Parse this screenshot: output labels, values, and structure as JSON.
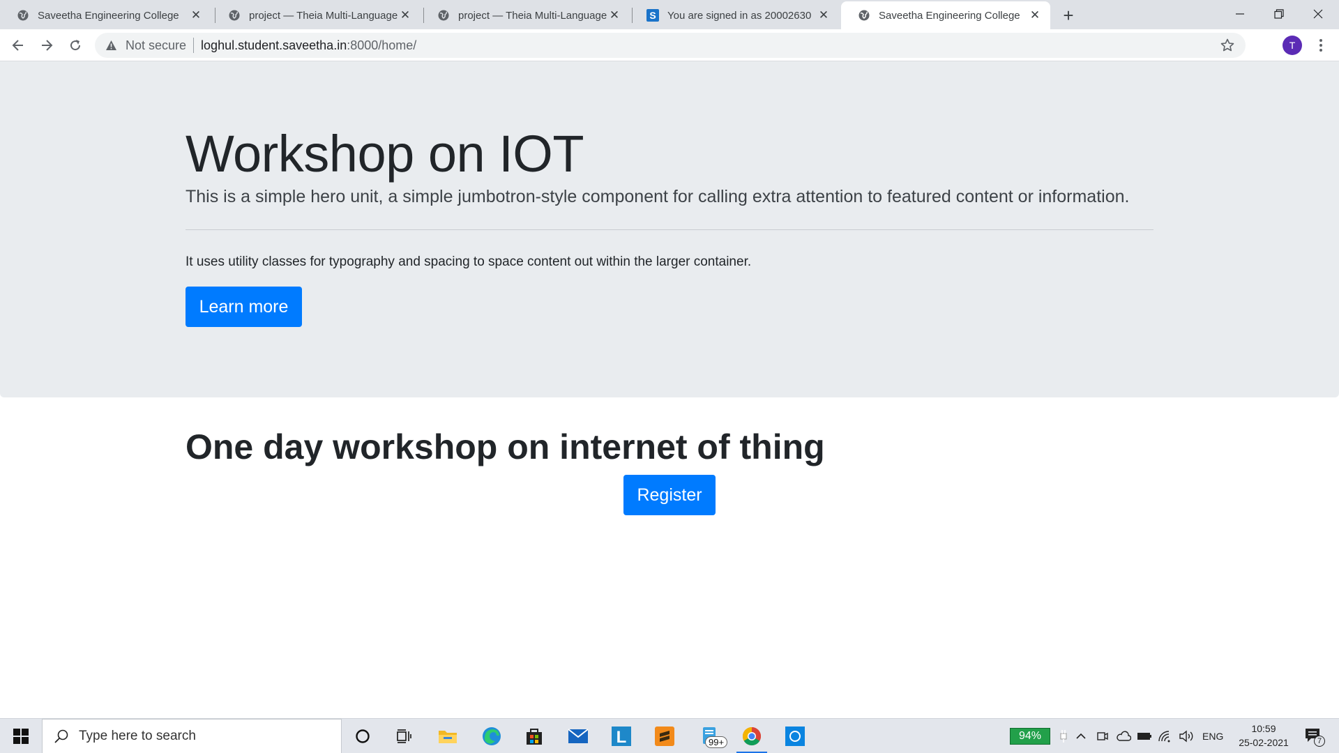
{
  "browser": {
    "tabs": [
      {
        "title": "Saveetha Engineering College",
        "favicon": "globe-icon",
        "active": false
      },
      {
        "title": "project — Theia Multi-Language",
        "favicon": "globe-icon",
        "active": false
      },
      {
        "title": "project — Theia Multi-Language",
        "favicon": "globe-icon",
        "active": false
      },
      {
        "title": "You are signed in as 20002630",
        "favicon": "s-brand-icon",
        "active": false
      },
      {
        "title": "Saveetha Engineering College",
        "favicon": "globe-icon",
        "active": true
      }
    ],
    "security_label": "Not secure",
    "url_host": "loghul.student.saveetha.in",
    "url_rest": ":8000/home/",
    "avatar_initial": "T"
  },
  "page": {
    "jumbotron": {
      "title": "Workshop on IOT",
      "lead": "This is a simple hero unit, a simple jumbotron-style component for calling extra attention to featured content or information.",
      "text": "It uses utility classes for typography and spacing to space content out within the larger container.",
      "button_label": "Learn more"
    },
    "section": {
      "heading": "One day workshop on internet of thing",
      "button_label": "Register"
    }
  },
  "taskbar": {
    "search_placeholder": "Type here to search",
    "mail_badge": "99+",
    "battery_percent": "94%",
    "language": "ENG",
    "time": "10:59",
    "date": "25-02-2021",
    "notification_count": "7"
  },
  "colors": {
    "primary": "#007bff",
    "jumbotron_bg": "#e9ecef",
    "tabstrip_bg": "#dee1e6"
  }
}
